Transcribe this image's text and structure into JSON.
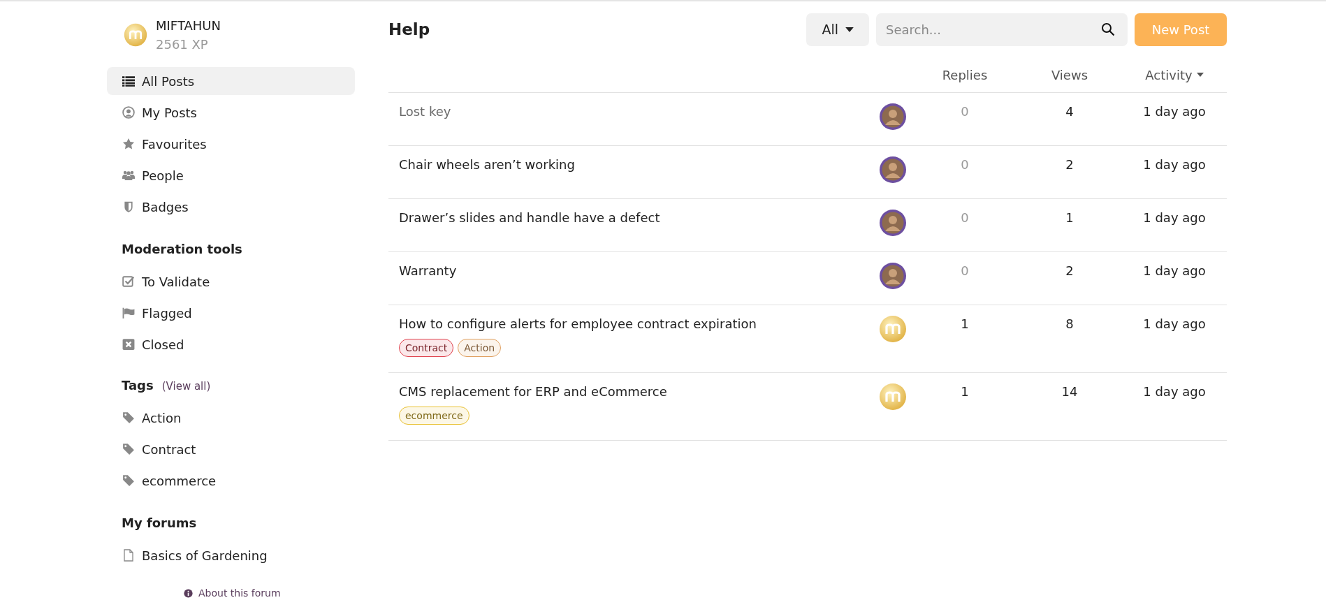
{
  "user": {
    "name": "MIFTAHUN",
    "xp": "2561 XP"
  },
  "nav": [
    {
      "label": "All Posts",
      "selected": true
    },
    {
      "label": "My Posts",
      "selected": false
    },
    {
      "label": "Favourites",
      "selected": false
    },
    {
      "label": "People",
      "selected": false
    },
    {
      "label": "Badges",
      "selected": false
    }
  ],
  "moderation": {
    "title": "Moderation tools",
    "items": [
      {
        "label": "To Validate"
      },
      {
        "label": "Flagged"
      },
      {
        "label": "Closed"
      }
    ]
  },
  "tags": {
    "title": "Tags",
    "link": "(View all)",
    "items": [
      {
        "label": "Action"
      },
      {
        "label": "Contract"
      },
      {
        "label": "ecommerce"
      }
    ]
  },
  "forums": {
    "title": "My forums",
    "items": [
      {
        "label": "Basics of Gardening"
      }
    ]
  },
  "about": "About this forum",
  "header": {
    "title": "Help",
    "filter": "All",
    "search_placeholder": "Search...",
    "new_post": "New Post"
  },
  "columns": {
    "replies": "Replies",
    "views": "Views",
    "activity": "Activity"
  },
  "posts": [
    {
      "title": "Lost key",
      "faded": true,
      "kind": "photo",
      "replies": "0",
      "has_replies": false,
      "views": "4",
      "activity": "1 day ago"
    },
    {
      "title": "Chair wheels aren’t working",
      "faded": false,
      "kind": "photo",
      "replies": "0",
      "has_replies": false,
      "views": "2",
      "activity": "1 day ago"
    },
    {
      "title": "Drawer’s slides and handle have a defect",
      "faded": false,
      "kind": "photo",
      "replies": "0",
      "has_replies": false,
      "views": "1",
      "activity": "1 day ago"
    },
    {
      "title": "Warranty",
      "faded": false,
      "kind": "photo",
      "replies": "0",
      "has_replies": false,
      "views": "2",
      "activity": "1 day ago"
    },
    {
      "title": "How to configure alerts for employee contract expiration",
      "faded": false,
      "kind": "logo",
      "replies": "1",
      "has_replies": true,
      "views": "8",
      "activity": "1 day ago",
      "tags": [
        {
          "label": "Contract",
          "color": "#e0424e"
        },
        {
          "label": "Action",
          "color": "#e0a060"
        }
      ]
    },
    {
      "title": "CMS replacement for ERP and eCommerce",
      "faded": false,
      "kind": "logo",
      "replies": "1",
      "has_replies": true,
      "views": "14",
      "activity": "1 day ago",
      "tags": [
        {
          "label": "ecommerce",
          "color": "#e8c030"
        }
      ]
    }
  ]
}
